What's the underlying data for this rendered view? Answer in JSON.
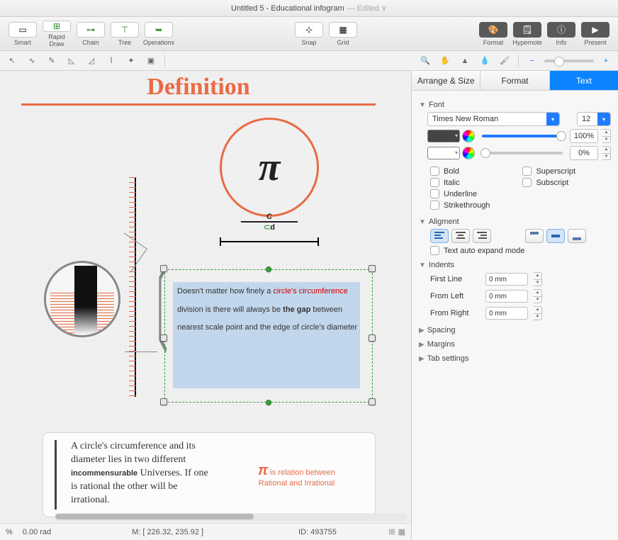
{
  "title": "Untitled 5 - Educational infogram",
  "edited": "— Edited ∨",
  "toolbar": {
    "smart": "Smart",
    "rapid": "Rapid Draw",
    "chain": "Chain",
    "tree": "Tree",
    "ops": "Operations",
    "snap": "Snap",
    "grid": "Grid",
    "format": "Format",
    "hypernote": "Hypernote",
    "info": "Info",
    "present": "Present"
  },
  "canvas": {
    "heading": "Definition",
    "pi": "π",
    "c": "C",
    "d": "d",
    "textblock": {
      "p1a": "Doesn't matter how finely a ",
      "p1red": "circle's circumference",
      "p1b": " division is there will always be ",
      "p1bold": "the gap",
      "p1c": " between nearest scale point and the edge of circle's diameter"
    },
    "note_left": "A circle's circumference and its diameter lies in two different incommensurable Universes. If one is rational the other will be irrational.",
    "note_left_bold": "incommensurable",
    "note_right_pi": "π",
    "note_right_a": " is relation between",
    "note_right_b": "Rational and Irrational"
  },
  "inspector": {
    "tabs": {
      "arrange": "Arrange & Size",
      "format": "Format",
      "text": "Text"
    },
    "font_section": "Font",
    "font_family": "Times New Roman",
    "font_size": "12",
    "opacity1": "100%",
    "opacity2": "0%",
    "checks": {
      "bold": "Bold",
      "italic": "Italic",
      "underline": "Underline",
      "strike": "Strikethrough",
      "super": "Superscript",
      "sub": "Subscript"
    },
    "alignment_section": "Aligment",
    "auto_expand": "Text auto expand mode",
    "indents_section": "Indents",
    "indents": {
      "first": "First Line",
      "left": "From Left",
      "right": "From Right",
      "val": "0 mm"
    },
    "spacing_section": "Spacing",
    "margins_section": "Margins",
    "tabs_section": "Tab settings"
  },
  "status": {
    "left1": "%",
    "left2": "0.00 rad",
    "mouse": "M: [ 226.32, 235.92 ]",
    "id": "ID: 493755"
  }
}
